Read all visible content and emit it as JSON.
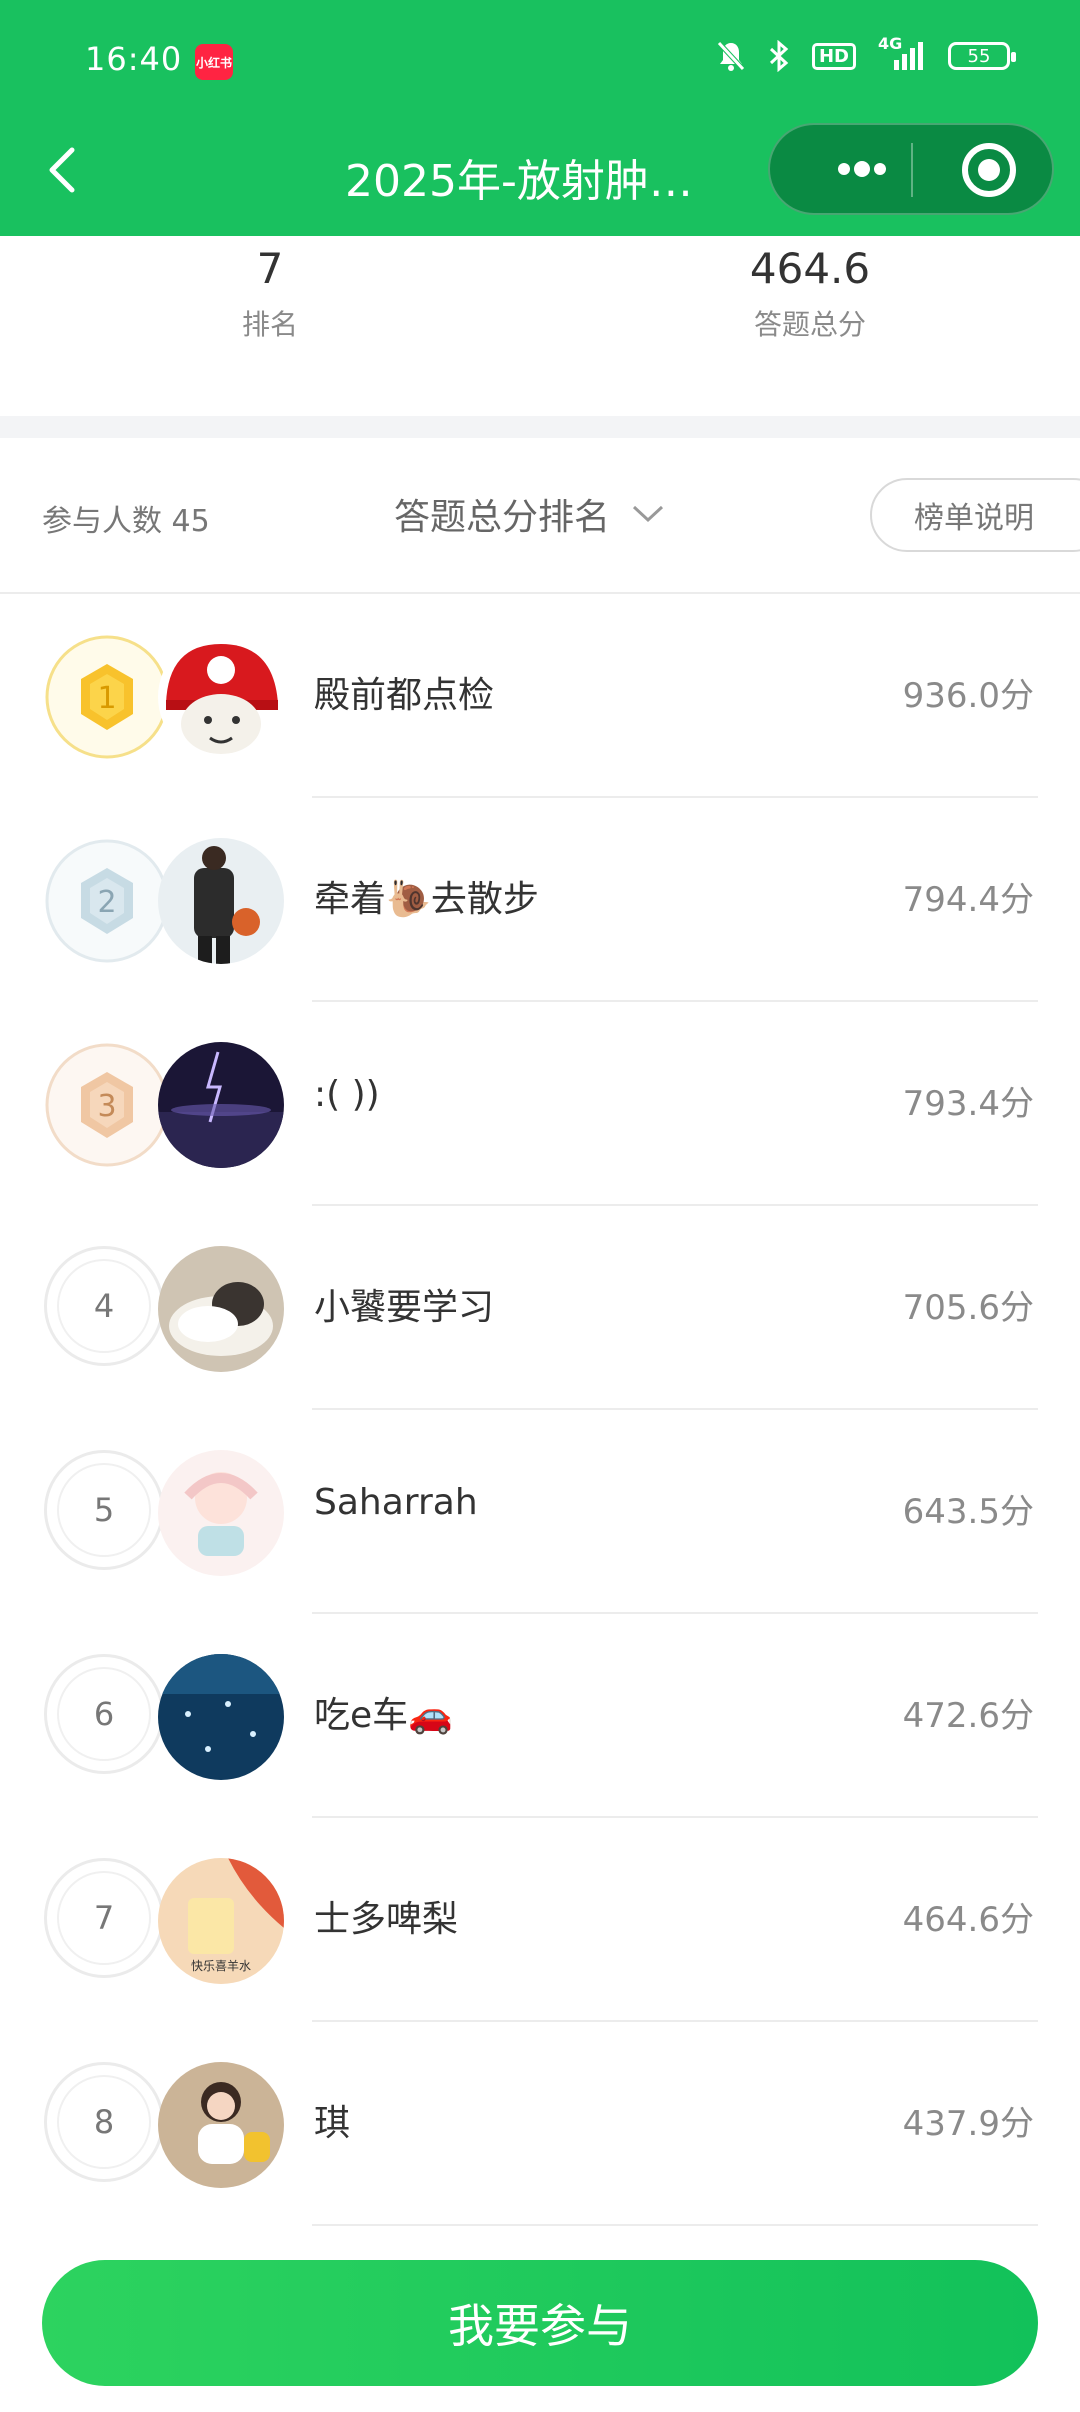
{
  "status_bar": {
    "time": "16:40",
    "app_badge": "小红书",
    "network": "4G",
    "hd": "HD",
    "battery": "55"
  },
  "header": {
    "title": "2025年-放射肿…",
    "accent_color": "#19c15f"
  },
  "summary": {
    "rank_value": "7",
    "rank_label": "排名",
    "score_value": "464.6",
    "score_label": "答题总分"
  },
  "filter": {
    "participants": "参与人数 45",
    "sort_label": "答题总分排名",
    "rules_button": "榜单说明"
  },
  "leaderboard": [
    {
      "rank": "1",
      "name": "殿前都点检",
      "score": "936.0分",
      "medal": "gold"
    },
    {
      "rank": "2",
      "name": "牵着🐌去散步",
      "score": "794.4分",
      "medal": "silver"
    },
    {
      "rank": "3",
      "name": ":( ))",
      "score": "793.4分",
      "medal": "bronze"
    },
    {
      "rank": "4",
      "name": "小饕要学习",
      "score": "705.6分",
      "medal": "none"
    },
    {
      "rank": "5",
      "name": "Saharrah",
      "score": "643.5分",
      "medal": "none"
    },
    {
      "rank": "6",
      "name": "吃e车🚗",
      "score": "472.6分",
      "medal": "none"
    },
    {
      "rank": "7",
      "name": "士多啤梨",
      "score": "464.6分",
      "medal": "none"
    },
    {
      "rank": "8",
      "name": "琪",
      "score": "437.9分",
      "medal": "none"
    }
  ],
  "avatar7_caption": "快乐喜羊水",
  "footer": {
    "join_button": "我要参与"
  }
}
